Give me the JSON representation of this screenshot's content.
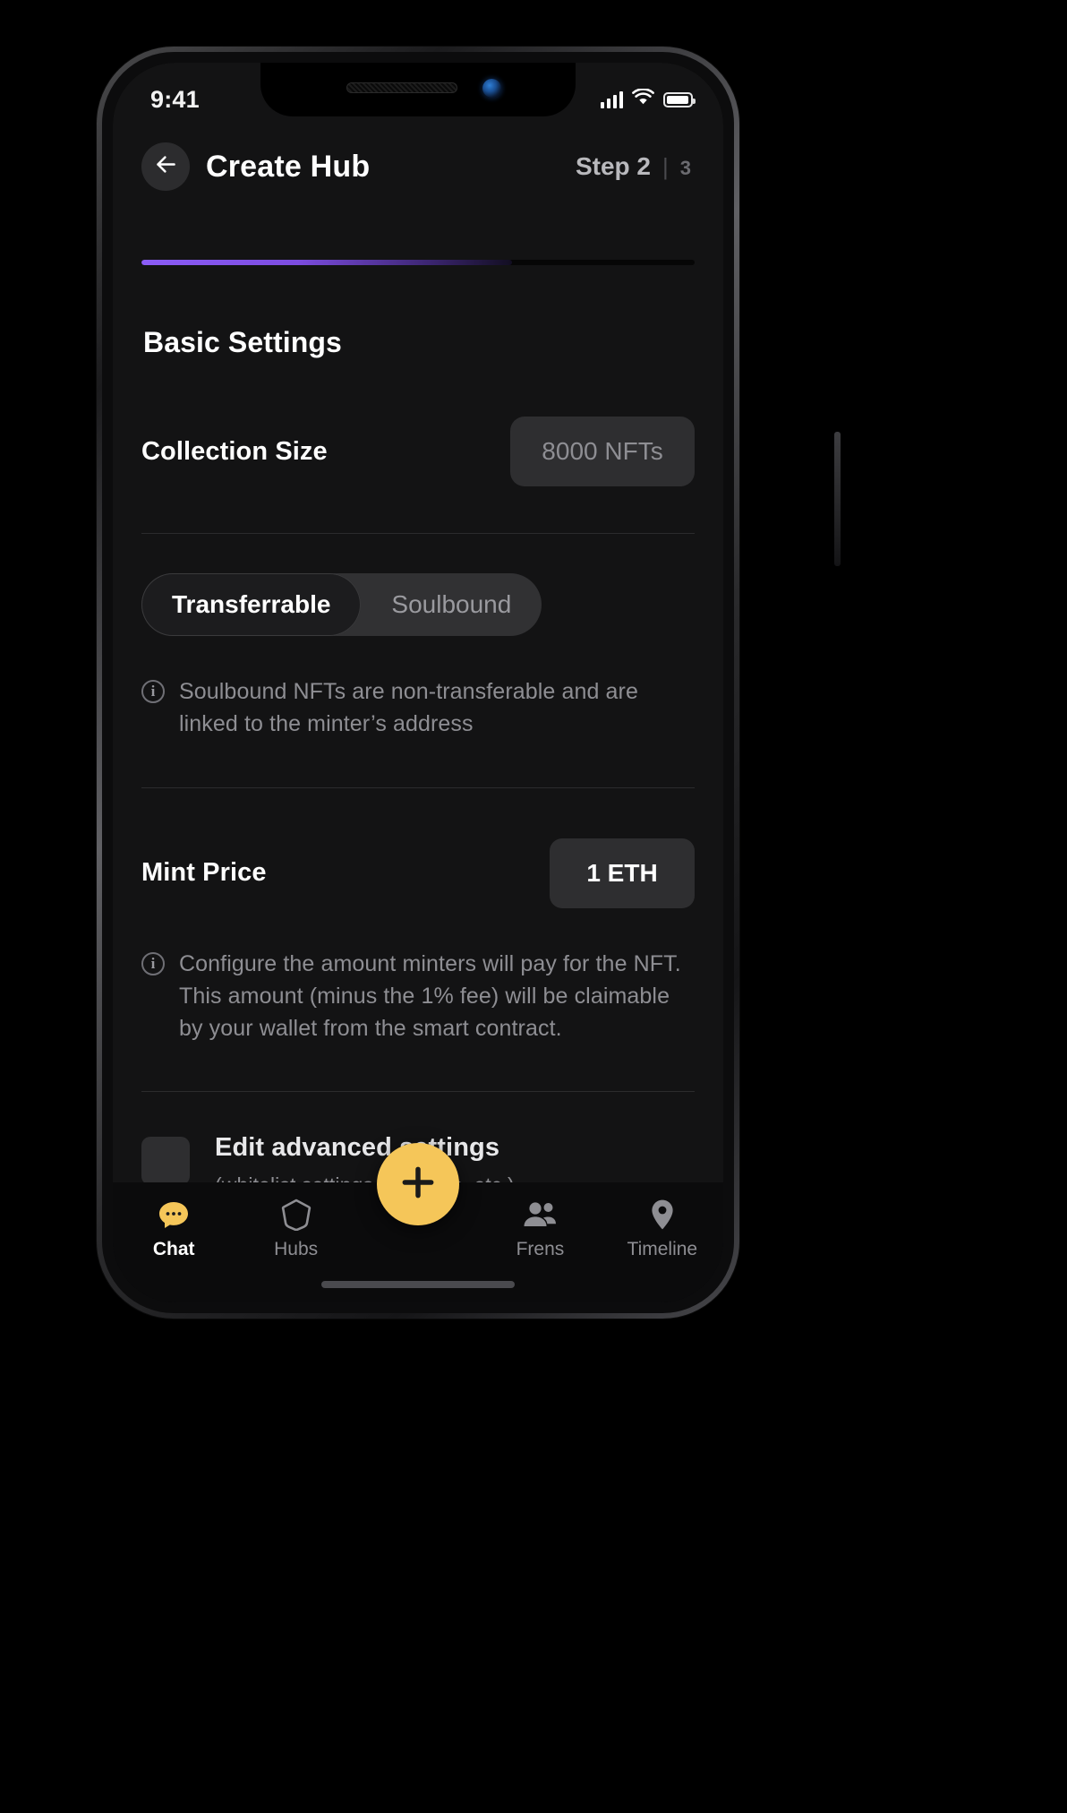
{
  "status_bar": {
    "time": "9:41",
    "signal_icon": "cellular-signal-icon",
    "wifi_icon": "wifi-icon",
    "battery_icon": "battery-icon"
  },
  "app_bar": {
    "back_icon": "back-arrow-icon",
    "title": "Create Hub",
    "step_current": "Step 2",
    "step_separator": "|",
    "step_total": "3"
  },
  "progress": {
    "percent": 67,
    "fill_color": "#8b5cf6",
    "track_color": "#060606"
  },
  "main": {
    "section_title": "Basic Settings",
    "collection_size": {
      "label": "Collection Size",
      "value": "8000 NFTs",
      "placeholder": "8000 NFTs"
    },
    "transfer_toggle": {
      "options": [
        "Transferrable",
        "Soulbound"
      ],
      "selected": "Transferrable"
    },
    "transfer_hint": {
      "icon": "info-circle-icon",
      "glyph": "i",
      "text": "Soulbound NFTs are non-transferable and are linked to the minter’s address"
    },
    "mint_price": {
      "label": "Mint Price",
      "value": "1 ETH",
      "placeholder": "1 ETH"
    },
    "mint_hint": {
      "icon": "info-circle-icon",
      "glyph": "i",
      "text": "Configure the amount minters will pay for the NFT. This amount (minus the 1% fee) will be claimable by your wallet from the smart contract."
    },
    "advanced": {
      "checked": false,
      "label": "Edit advanced settings",
      "subtitle": "(whitelist settings, royalties,  etc.)"
    }
  },
  "tab_bar": {
    "fab_icon": "plus-icon",
    "fab_color": "#f5c659",
    "items": [
      {
        "label": "Chat",
        "icon": "chat-bubble-icon",
        "active": true
      },
      {
        "label": "Hubs",
        "icon": "hexagon-icon",
        "active": false
      },
      {
        "label": "Frens",
        "icon": "people-icon",
        "active": false
      },
      {
        "label": "Timeline",
        "icon": "map-pin-icon",
        "active": false
      }
    ]
  }
}
